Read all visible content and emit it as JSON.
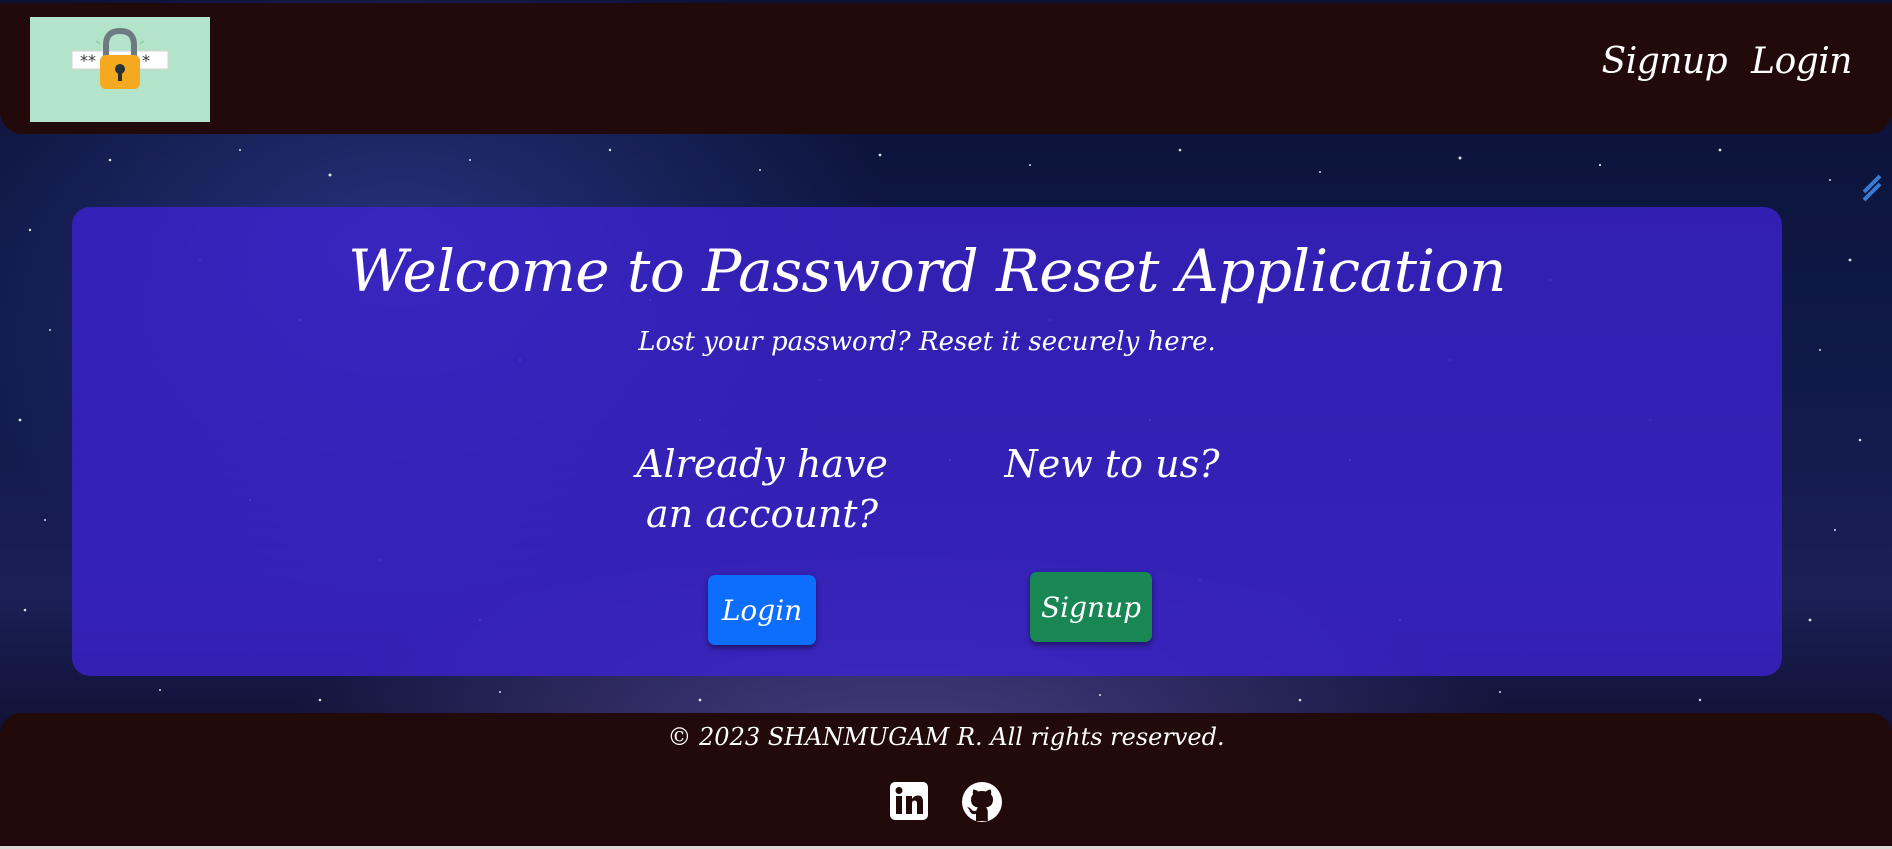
{
  "navbar": {
    "logo_icon": "password-lock-icon",
    "links": [
      {
        "label": "Signup"
      },
      {
        "label": "Login"
      }
    ]
  },
  "hero": {
    "title": "Welcome to Password Reset Application",
    "subtitle": "Lost your password? Reset it securely here.",
    "login_section": {
      "heading": "Already have an account?",
      "button_label": "Login"
    },
    "signup_section": {
      "heading": "New to us?",
      "button_label": "Signup"
    }
  },
  "footer": {
    "copyright": "© 2023 SHANMUGAM R. All rights reserved.",
    "social": [
      {
        "icon": "linkedin-icon"
      },
      {
        "icon": "github-icon"
      }
    ]
  },
  "colors": {
    "navbar_bg": "#220a0a",
    "card_bg": "#3c23d2",
    "login_button": "#0d6efd",
    "signup_button": "#198754",
    "logo_bg": "#b3e3c9"
  }
}
